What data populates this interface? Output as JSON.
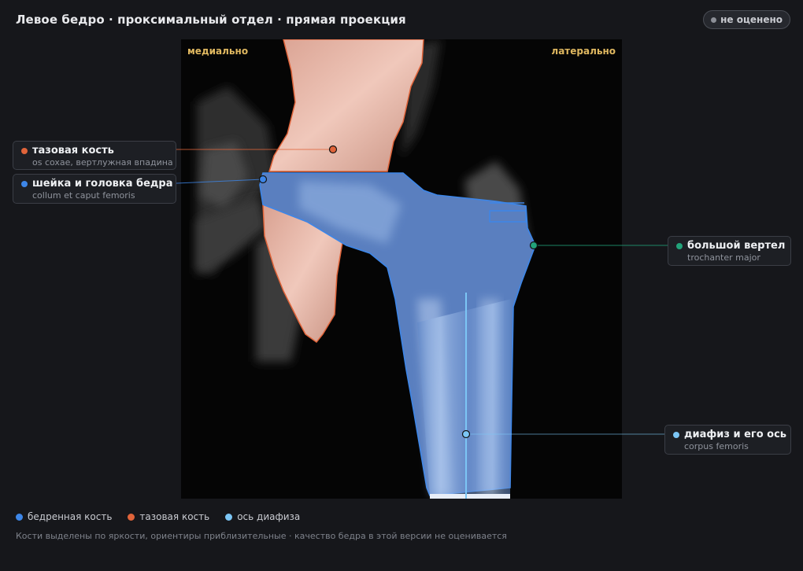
{
  "header": {
    "title": "Левое бедро · проксимальный отдел · прямая проекция",
    "status": "не оценено"
  },
  "viewer": {
    "orient_left": "медиально",
    "orient_right": "латерально"
  },
  "landmarks": [
    {
      "name": "тазовая кость",
      "latin": "os coxae, вертлужная впадина",
      "color": "#e0643a"
    },
    {
      "name": "шейка и головка бедра",
      "latin": "collum et caput femoris",
      "color": "#3d86e8"
    },
    {
      "name": "большой вертел",
      "latin": "trochanter major",
      "color": "#22a37a"
    },
    {
      "name": "диафиз и его ось",
      "latin": "corpus femoris",
      "color": "#7cc6f5"
    }
  ],
  "legend": [
    {
      "label": "бедренная кость",
      "color": "#3d86e8"
    },
    {
      "label": "тазовая кость",
      "color": "#e0643a"
    },
    {
      "label": "ось диафиза",
      "color": "#7cc6f5"
    }
  ],
  "footnote": "Кости выделены по яркости, ориентиры приблизительные · качество бедра в этой версии не оценивается",
  "colors": {
    "femur": "#3d86e8",
    "pelvis": "#e0643a",
    "shaft_axis": "#7cc6f5",
    "trochanter": "#22a37a",
    "orient_text": "#e0b860"
  }
}
